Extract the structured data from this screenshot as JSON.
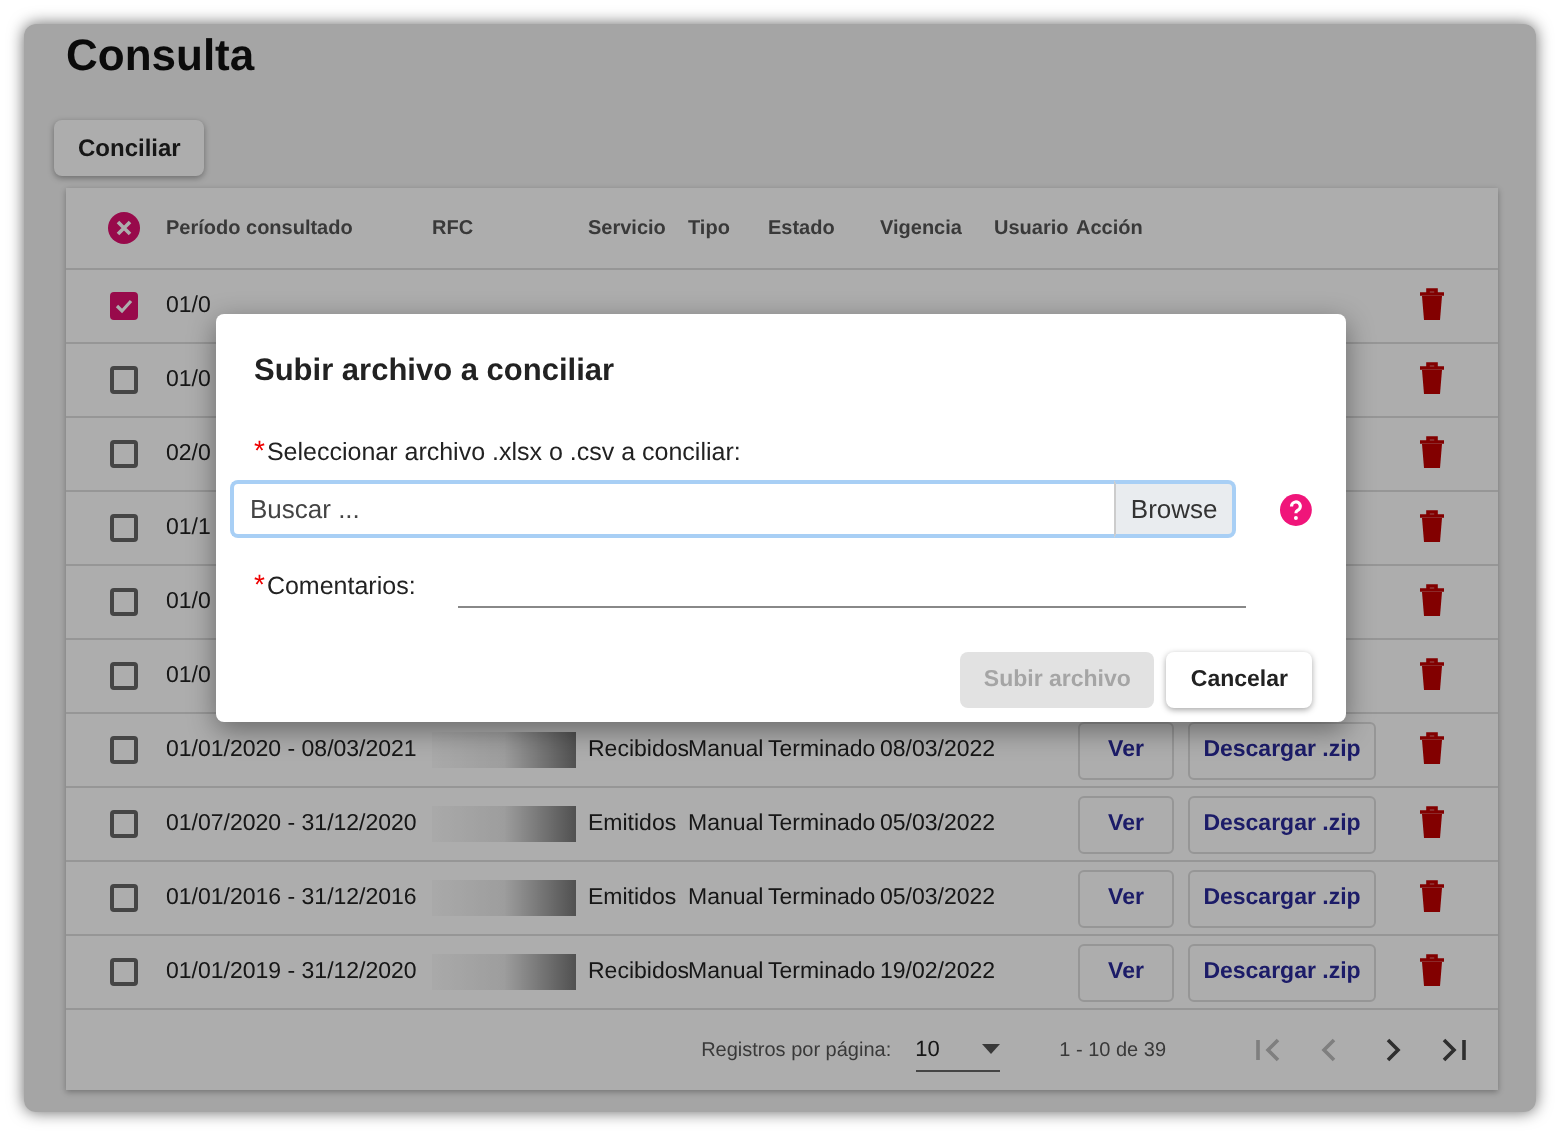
{
  "page": {
    "title": "Consulta"
  },
  "toolbar": {
    "buttons": [
      "Conciliar"
    ]
  },
  "table": {
    "columns": [
      "Período consultado",
      "RFC",
      "Servicio",
      "Tipo",
      "Estado",
      "Vigencia",
      "Usuario",
      "Acción"
    ],
    "rows": [
      {
        "kind": "covered",
        "selected": true,
        "period": "01/0"
      },
      {
        "kind": "covered",
        "selected": false,
        "period": "01/0"
      },
      {
        "kind": "covered",
        "selected": false,
        "period": "02/0"
      },
      {
        "kind": "covered",
        "selected": false,
        "period": "01/1"
      },
      {
        "kind": "covered",
        "selected": false,
        "period": "01/0"
      },
      {
        "kind": "covered",
        "selected": false,
        "period": "01/0"
      },
      {
        "kind": "full",
        "selected": false,
        "period": "01/01/2020 - 08/03/2021",
        "service": "Recibidos",
        "type": "Manual",
        "status": "Terminado",
        "validity": "08/03/2022",
        "view": "Ver",
        "download": "Descargar .zip"
      },
      {
        "kind": "full",
        "selected": false,
        "period": "01/07/2020 - 31/12/2020",
        "service": "Emitidos",
        "type": "Manual",
        "status": "Terminado",
        "validity": "05/03/2022",
        "view": "Ver",
        "download": "Descargar .zip"
      },
      {
        "kind": "full",
        "selected": false,
        "period": "01/01/2016 - 31/12/2016",
        "service": "Emitidos",
        "type": "Manual",
        "status": "Terminado",
        "validity": "05/03/2022",
        "view": "Ver",
        "download": "Descargar .zip"
      },
      {
        "kind": "full",
        "selected": false,
        "period": "01/01/2019 - 31/12/2020",
        "service": "Recibidos",
        "type": "Manual",
        "status": "Terminado",
        "validity": "19/02/2022",
        "view": "Ver",
        "download": "Descargar .zip"
      }
    ],
    "pagination": {
      "label": "Registros por página:",
      "per_page": "10",
      "range": "1 - 10 de 39",
      "nav": [
        {
          "kind": "first",
          "disabled": true
        },
        {
          "kind": "prev",
          "disabled": true
        },
        {
          "kind": "next",
          "disabled": false
        },
        {
          "kind": "last",
          "disabled": false
        }
      ]
    }
  },
  "dialog": {
    "title": "Subir archivo a conciliar",
    "fields": [
      {
        "kind": "file",
        "mark": "*",
        "label": "Seleccionar archivo .xlsx o .csv a conciliar:",
        "placeholder": "Buscar ...",
        "button": "Browse",
        "focused": true
      },
      {
        "kind": "text",
        "mark": "*",
        "label": "Comentarios:"
      }
    ],
    "actions": [
      {
        "label": "Subir archivo",
        "disabled": true
      },
      {
        "label": "Cancelar",
        "disabled": false
      }
    ]
  }
}
